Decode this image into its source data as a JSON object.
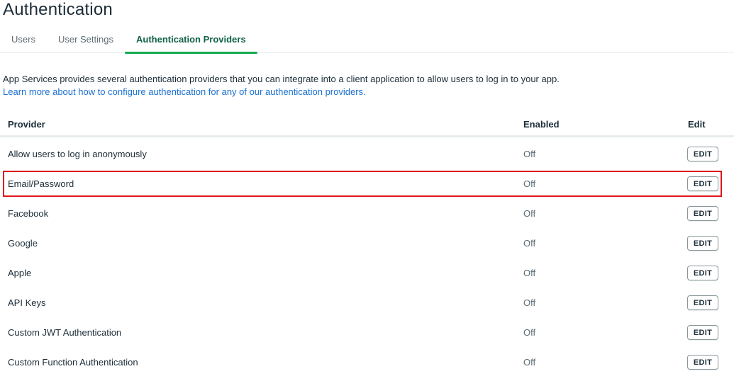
{
  "page": {
    "title": "Authentication"
  },
  "tabs": [
    {
      "label": "Users",
      "active": false
    },
    {
      "label": "User Settings",
      "active": false
    },
    {
      "label": "Authentication Providers",
      "active": true
    }
  ],
  "intro": {
    "text": "App Services provides several authentication providers that you can integrate into a client application to allow users to log in to your app.",
    "link": "Learn more about how to configure authentication for any of our authentication providers."
  },
  "table": {
    "headers": {
      "provider": "Provider",
      "enabled": "Enabled",
      "edit": "Edit"
    },
    "rows": [
      {
        "provider": "Allow users to log in anonymously",
        "enabled": "Off",
        "edit": "EDIT"
      },
      {
        "provider": "Email/Password",
        "enabled": "Off",
        "edit": "EDIT"
      },
      {
        "provider": "Facebook",
        "enabled": "Off",
        "edit": "EDIT"
      },
      {
        "provider": "Google",
        "enabled": "Off",
        "edit": "EDIT"
      },
      {
        "provider": "Apple",
        "enabled": "Off",
        "edit": "EDIT"
      },
      {
        "provider": "API Keys",
        "enabled": "Off",
        "edit": "EDIT"
      },
      {
        "provider": "Custom JWT Authentication",
        "enabled": "Off",
        "edit": "EDIT"
      },
      {
        "provider": "Custom Function Authentication",
        "enabled": "Off",
        "edit": "EDIT"
      }
    ]
  },
  "colors": {
    "accent": "#13aa52",
    "active_tab_text": "#116149",
    "link": "#1a6fd1",
    "highlight": "#e0141c"
  }
}
